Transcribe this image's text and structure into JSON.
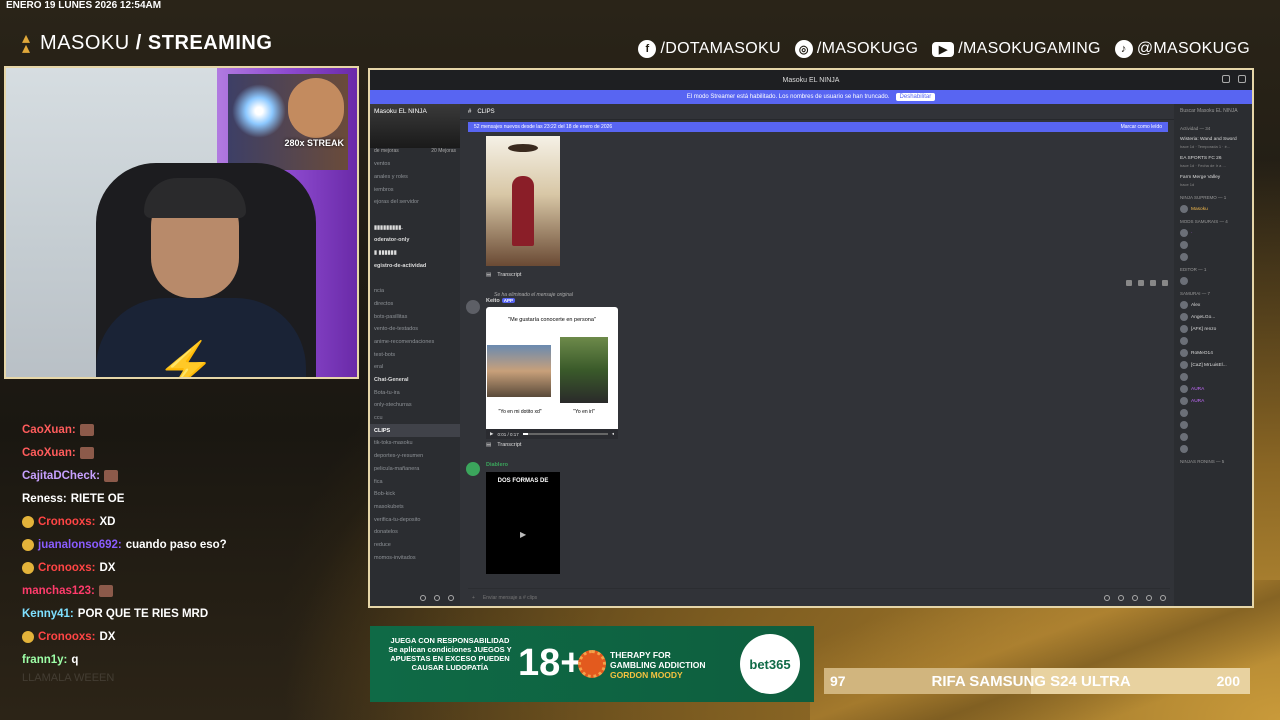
{
  "overlay": {
    "datetime": "ENERO 19 LUNES 2026 12:54AM",
    "brand_light": "MASOKU",
    "brand_bold": "/ STREAMING",
    "socials": [
      {
        "icon": "facebook-icon",
        "label": "/DOTAMASOKU"
      },
      {
        "icon": "instagram-icon",
        "label": "/MASOKUGG"
      },
      {
        "icon": "youtube-icon",
        "label": "/MASOKUGAMING"
      },
      {
        "icon": "tiktok-icon",
        "label": "@MASOKUGG"
      }
    ],
    "streak_label": "280x STREAK",
    "colors": {
      "accent": "#e0a83a",
      "frame": "#e6d6a8"
    }
  },
  "chat": [
    {
      "user": "CaoXuan:",
      "color": "#ff5c5c",
      "msg": "",
      "emote": true,
      "badge": false
    },
    {
      "user": "CaoXuan:",
      "color": "#ff5c5c",
      "msg": "",
      "emote": true,
      "badge": false
    },
    {
      "user": "CajitaDCheck:",
      "color": "#c7a0ff",
      "msg": "",
      "emote": true,
      "badge": false
    },
    {
      "user": "Reness:",
      "color": "#ffffff",
      "msg": "RIETE OE",
      "emote": false,
      "badge": false
    },
    {
      "user": "Cronooxs:",
      "color": "#ff4545",
      "msg": "XD",
      "emote": false,
      "badge": true
    },
    {
      "user": "juanalonso692:",
      "color": "#8a5cff",
      "msg": "cuando paso eso?",
      "emote": false,
      "badge": true
    },
    {
      "user": "Cronooxs:",
      "color": "#ff4545",
      "msg": "DX",
      "emote": false,
      "badge": true
    },
    {
      "user": "manchas123:",
      "color": "#ff3b6b",
      "msg": "",
      "emote": true,
      "badge": false
    },
    {
      "user": "Kenny41:",
      "color": "#7fe0ff",
      "msg": "POR QUE TE RIES MRD",
      "emote": false,
      "badge": false
    },
    {
      "user": "Cronooxs:",
      "color": "#ff4545",
      "msg": "DX",
      "emote": false,
      "badge": true
    },
    {
      "user": "frann1y:",
      "color": "#9effa8",
      "msg": "q",
      "emote": false,
      "badge": false
    }
  ],
  "chat_faded": "LLAMALA WEEEN",
  "discord": {
    "window_title": "Masoku EL NINJA",
    "notice": "El modo Streamer está habilitado. Los nombres de usuario se han truncado.",
    "notice_button": "Deshabilitar",
    "server_name": "Masoku EL NINJA",
    "boost_left": "de mejoras",
    "boost_right": "20 Mejoras",
    "channel_name": "CLIPS",
    "new_messages": "52 mensajes nuevos desde las 23:22 del 18 de enero de 2026",
    "mark_read": "Marcar como leído",
    "channels": [
      {
        "label": "ventos",
        "style": "dim"
      },
      {
        "label": "anales y roles",
        "style": "dim"
      },
      {
        "label": "iembros",
        "style": "dim"
      },
      {
        "label": "ejoras del servidor",
        "style": "dim"
      },
      {
        "label": "",
        "style": "dim"
      },
      {
        "label": "▮▮▮▮▮▮▮▮▮.",
        "style": "bright"
      },
      {
        "label": "oderator-only",
        "style": "bright"
      },
      {
        "label": "▮ ▮▮▮▮▮▮",
        "style": "bright"
      },
      {
        "label": "egistro-de-actividad",
        "style": "bright"
      },
      {
        "label": "",
        "style": "dim"
      },
      {
        "label": "ncia",
        "style": "dim"
      },
      {
        "label": "directos",
        "style": "dim"
      },
      {
        "label": "bots-pasillitas",
        "style": "dim"
      },
      {
        "label": "vento-de-testados",
        "style": "dim"
      },
      {
        "label": "anime-recomendaciones",
        "style": "dim"
      },
      {
        "label": "test-bots",
        "style": "dim"
      },
      {
        "label": "eral",
        "style": "dim"
      },
      {
        "label": "Chat-General",
        "style": "bright"
      },
      {
        "label": "Bota-tu-ira",
        "style": "dim"
      },
      {
        "label": "only-stechurras",
        "style": "dim"
      },
      {
        "label": "ccu",
        "style": "dim"
      },
      {
        "label": "CLIPS",
        "style": "active"
      },
      {
        "label": "tik-toks-masoku",
        "style": "dim"
      },
      {
        "label": "deportes-y-resumen",
        "style": "dim"
      },
      {
        "label": "pelicula-mañanera",
        "style": "dim"
      },
      {
        "label": "fica",
        "style": "dim"
      },
      {
        "label": "Bob-kick",
        "style": "dim"
      },
      {
        "label": "masokubets",
        "style": "dim"
      },
      {
        "label": "verifica-tu-deposito",
        "style": "dim"
      },
      {
        "label": "donatelos",
        "style": "dim"
      },
      {
        "label": "reduce",
        "style": "dim"
      },
      {
        "label": "momos-invitados",
        "style": "dim"
      }
    ],
    "transcript_label": "Transcript",
    "reply_note": "Se ha eliminado el mensaje original",
    "msg2_user": "Keito",
    "msg2_tag": "APP",
    "card_title": "\"Me gustaría conocerte en persona\"",
    "card_cap1": "\"Yo en mi dotito xd\"",
    "card_cap2": "\"Yo en irl\"",
    "card_time": "0:01 / 0:17",
    "card_progress": 0.06,
    "msg3_user": "Diablero",
    "vid2_title": "DOS FORMAS DE",
    "composer_placeholder": "Enviar mensaje a # clips",
    "search_placeholder": "Buscar Masoku EL NINJA",
    "activity_header": "Actividad — 34",
    "activities": [
      {
        "title": "Wisteria: Wand and Sword",
        "sub": "hace 1d · Temporada 1 · é..."
      },
      {
        "title": "EA SPORTS FC 26",
        "sub": "hace 1d · Fecha de Ir a ..."
      },
      {
        "title": "Farm Merge Valley",
        "sub": "hace 1d"
      }
    ],
    "member_sections": [
      {
        "header": "NINJA SUPREMO — 1",
        "members": [
          {
            "name": "Masoku",
            "color": "#f2b84b"
          }
        ]
      },
      {
        "header": "MODS SAMURAIS — 4",
        "members": [
          {
            "name": "·",
            "color": "#c56bff"
          },
          {
            "name": "",
            "color": "#ff5c5c"
          },
          {
            "name": "",
            "color": "#ff5c5c"
          }
        ]
      },
      {
        "header": "EDITOR — 1",
        "members": [
          {
            "name": "",
            "color": "#ff5c5c"
          }
        ]
      },
      {
        "header": "SAMURAI — 7",
        "members": [
          {
            "name": "Alex",
            "color": "#dddddd"
          },
          {
            "name": "AngeLGo...",
            "color": "#dddddd"
          },
          {
            "name": "[AFK] renzo",
            "color": "#dddddd"
          },
          {
            "name": "",
            "color": "#dddddd"
          },
          {
            "name": "RoMeO14",
            "color": "#dddddd"
          },
          {
            "name": "[CaZ] MrLuisEl...",
            "color": "#dddddd"
          },
          {
            "name": "",
            "color": "#dddddd"
          }
        ]
      },
      {
        "header": "",
        "members": [
          {
            "name": "AURA",
            "color": "#c56bff"
          },
          {
            "name": "AURA",
            "color": "#c56bff"
          },
          {
            "name": "",
            "color": "#ff5c5c"
          },
          {
            "name": "",
            "color": "#ff5c5c"
          },
          {
            "name": "",
            "color": "#ff5c5c"
          },
          {
            "name": "",
            "color": "#ff5c5c"
          }
        ]
      },
      {
        "header": "NINJAS RONINS — 5",
        "members": []
      }
    ]
  },
  "ad": {
    "left_text": "JUEGA CON RESPONSABILIDAD Se aplican condiciones JUEGOS Y APUESTAS EN EXCESO PUEDEN CAUSAR LUDOPATÍA",
    "age": "18+",
    "therapy_line1": "THERAPY FOR",
    "therapy_line2": "GAMBLING ADDICTION",
    "therapy_line3": "GORDON MOODY",
    "brand": "bet365"
  },
  "raffle": {
    "current": "97",
    "title": "RIFA SAMSUNG S24 ULTRA",
    "goal": "200",
    "progress": 0.485
  }
}
